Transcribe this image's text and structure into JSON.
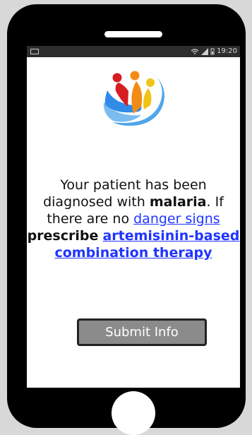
{
  "device": {
    "status_bar": {
      "time": "19:20",
      "icons": [
        "notification-icon",
        "wifi-icon",
        "signal-icon",
        "battery-icon"
      ]
    }
  },
  "screen": {
    "logo": {
      "icon": "care-hand-logo-icon",
      "colors": {
        "blue": "#2f8be8",
        "red": "#d71d22",
        "orange": "#f28b15",
        "yellow": "#f2c316"
      }
    },
    "message": {
      "part1": "Your patient has been diagnosed with ",
      "malaria": "malaria",
      "part2": ". If there are no ",
      "danger_signs": "danger signs",
      "part3": " prescribe",
      "therapy": "artemisinin-based combination therapy"
    },
    "submit_label": "Submit Info"
  },
  "colors": {
    "phone_body": "#000000",
    "link": "#1f35ff",
    "button": "#8b8b8b",
    "background": "#d8d8d8"
  }
}
